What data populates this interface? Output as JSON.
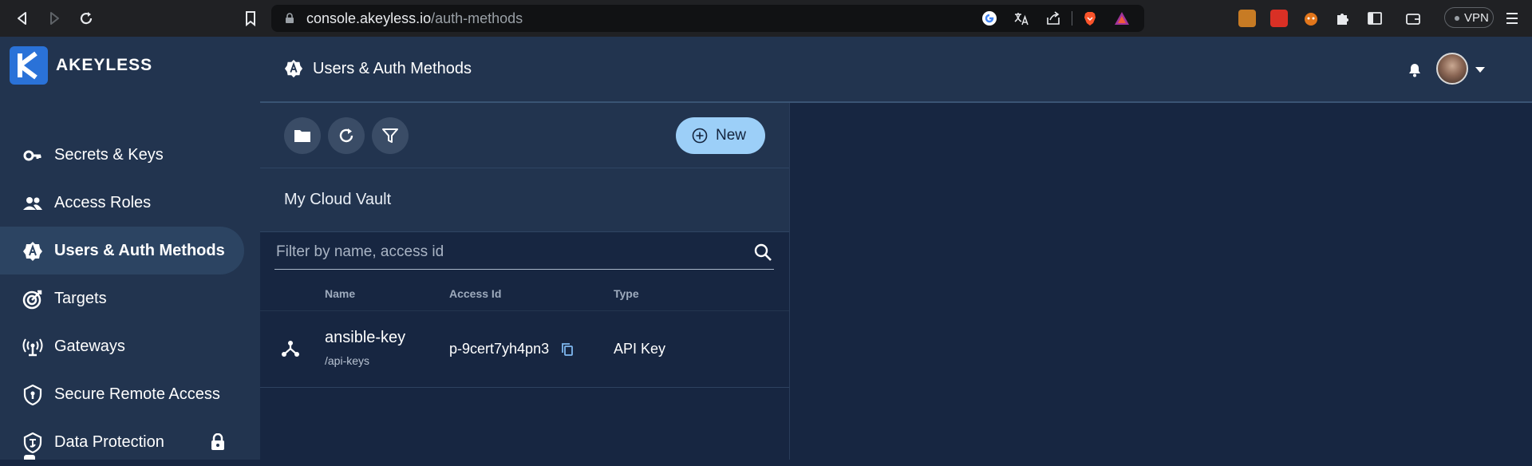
{
  "browser": {
    "url_host": "console.akeyless.io",
    "url_path": "/auth-methods",
    "vpn_label": "VPN"
  },
  "sidebar": {
    "brand": "AKEYLESS",
    "items": [
      {
        "label": "Secrets & Keys",
        "icon": "key-icon"
      },
      {
        "label": "Access Roles",
        "icon": "people-icon"
      },
      {
        "label": "Users & Auth Methods",
        "icon": "auth-badge-icon",
        "active": true
      },
      {
        "label": "Targets",
        "icon": "target-icon"
      },
      {
        "label": "Gateways",
        "icon": "gateway-icon"
      },
      {
        "label": "Secure Remote Access",
        "icon": "shield-lock-icon"
      },
      {
        "label": "Data Protection",
        "icon": "shield-icon",
        "locked": true
      }
    ]
  },
  "header": {
    "title": "Users & Auth Methods"
  },
  "panel": {
    "new_label": "New",
    "vault_name": "My Cloud Vault",
    "filter_placeholder": "Filter by name, access id",
    "columns": [
      "Name",
      "Access Id",
      "Type"
    ],
    "rows": [
      {
        "name": "ansible-key",
        "path": "/api-keys",
        "access_id": "p-9cert7yh4pn3",
        "type": "API Key"
      }
    ]
  },
  "colors": {
    "sidebar_bg": "#22344f",
    "main_bg": "#172641",
    "active_item": "#2c4462",
    "new_button": "#9ccff8",
    "logo": "#2a72d8"
  }
}
